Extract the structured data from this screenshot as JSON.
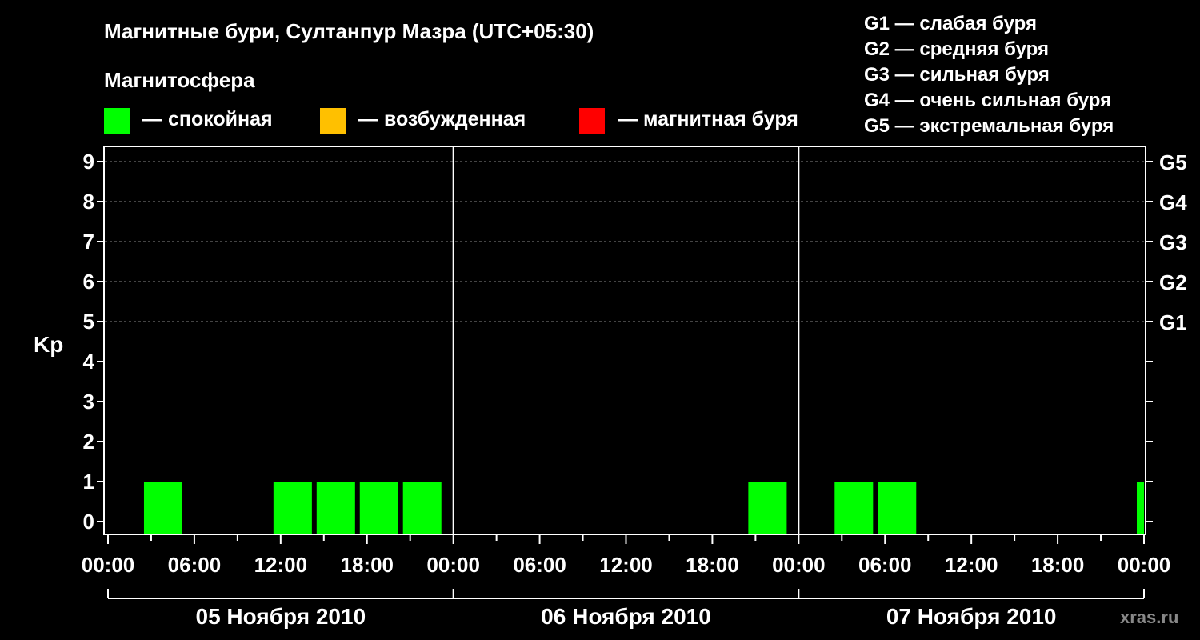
{
  "chart_data": {
    "type": "bar",
    "title": "Магнитные бури, Султанпур Мазра (UTC+05:30)",
    "legend_title": "Магнитосфера",
    "legend": [
      {
        "label": "— спокойная",
        "color": "#00ff00"
      },
      {
        "label": "— возбужденная",
        "color": "#ffc000"
      },
      {
        "label": "— магнитная буря",
        "color": "#ff0000"
      }
    ],
    "storm_scale": [
      "G1 — слабая буря",
      "G2 — средняя буря",
      "G3 — сильная буря",
      "G4 — очень сильная буря",
      "G5 — экстремальная буря"
    ],
    "ylabel": "Kp",
    "ylim": [
      0,
      9
    ],
    "y_ticks": [
      "0",
      "1",
      "2",
      "3",
      "4",
      "5",
      "6",
      "7",
      "8",
      "9"
    ],
    "right_ticks": [
      {
        "kp": 5,
        "label": "G1"
      },
      {
        "kp": 6,
        "label": "G2"
      },
      {
        "kp": 7,
        "label": "G3"
      },
      {
        "kp": 8,
        "label": "G4"
      },
      {
        "kp": 9,
        "label": "G5"
      }
    ],
    "grid": "dashed at Kp 5-9",
    "x_tick_labels": [
      "00:00",
      "06:00",
      "12:00",
      "18:00",
      "00:00",
      "06:00",
      "12:00",
      "18:00",
      "00:00",
      "06:00",
      "12:00",
      "18:00",
      "00:00"
    ],
    "days": [
      "05 Ноября 2010",
      "06 Ноября 2010",
      "07 Ноября 2010"
    ],
    "bars": [
      {
        "start_hour": 2.5,
        "kp": 1,
        "state": "спокойная"
      },
      {
        "start_hour": 11.5,
        "kp": 1,
        "state": "спокойная"
      },
      {
        "start_hour": 14.5,
        "kp": 1,
        "state": "спокойная"
      },
      {
        "start_hour": 17.5,
        "kp": 1,
        "state": "спокойная"
      },
      {
        "start_hour": 20.5,
        "kp": 1,
        "state": "спокойная"
      },
      {
        "start_hour": 44.5,
        "kp": 1,
        "state": "спокойная"
      },
      {
        "start_hour": 50.5,
        "kp": 1,
        "state": "спокойная"
      },
      {
        "start_hour": 53.5,
        "kp": 1,
        "state": "спокойная"
      },
      {
        "start_hour": 71.5,
        "kp": 1,
        "state": "спокойная",
        "end_hour": 72
      }
    ]
  },
  "watermark": "xras.ru"
}
